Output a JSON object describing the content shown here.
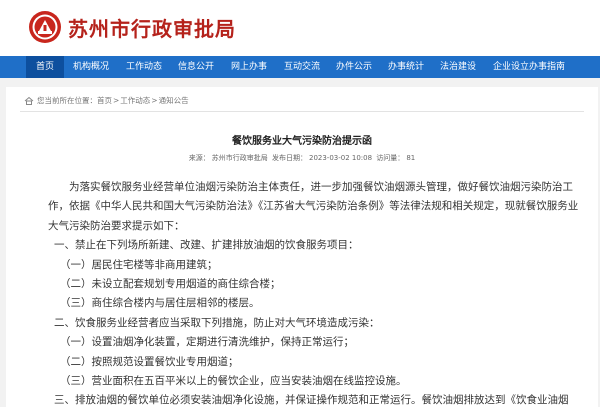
{
  "site": {
    "title": "苏州市行政审批局",
    "logo_icon": "government-emblem-icon",
    "brand_color": "#b5221b"
  },
  "nav": {
    "color": "#1f6fc8",
    "items": [
      {
        "label": "首页",
        "active": true
      },
      {
        "label": "机构概况"
      },
      {
        "label": "工作动态"
      },
      {
        "label": "信息公开"
      },
      {
        "label": "网上办事"
      },
      {
        "label": "互动交流"
      },
      {
        "label": "办件公示"
      },
      {
        "label": "办事统计"
      },
      {
        "label": "法治建设"
      },
      {
        "label": "企业设立办事指南"
      }
    ]
  },
  "breadcrumb": {
    "prefix": "您当前所在位置：",
    "items": [
      "首页",
      "工作动态",
      "通知公告"
    ],
    "separator": ">"
  },
  "article": {
    "title": "餐饮服务业大气污染防治提示函",
    "source_label": "来源：",
    "source": "苏州市行政审批局",
    "date_label": "发布日期：",
    "date": "2023-03-02 10:08",
    "views_label": "访问量：",
    "views": "81",
    "paragraphs": [
      "为落实餐饮服务业经营单位油烟污染防治主体责任，进一步加强餐饮油烟源头管理，做好餐饮油烟污染防治工",
      "作，依据《中华人民共和国大气污染防治法》《江苏省大气污染防治条例》等法律法规和相关规定，现就餐饮服务业",
      "大气污染防治要求提示如下：",
      "一、禁止在下列场所新建、改建、扩建排放油烟的饮食服务项目：",
      "（一）居民住宅楼等非商用建筑；",
      "（二）未设立配套规划专用烟道的商住综合楼；",
      "（三）商住综合楼内与居住层相邻的楼层。",
      "二、饮食服务业经营者应当采取下列措施，防止对大气环境造成污染：",
      "（一）设置油烟净化装置，定期进行清洗维护，保持正常运行；",
      "（二）按照规范设置餐饮业专用烟道；",
      "（三）营业面积在五百平米以上的餐饮企业，应当安装油烟在线监控设施。",
      "三、排放油烟的餐饮单位必须安装油烟净化设施，并保证操作规范和正常运行。餐饮油烟排放达到《饮食业油烟"
    ]
  }
}
